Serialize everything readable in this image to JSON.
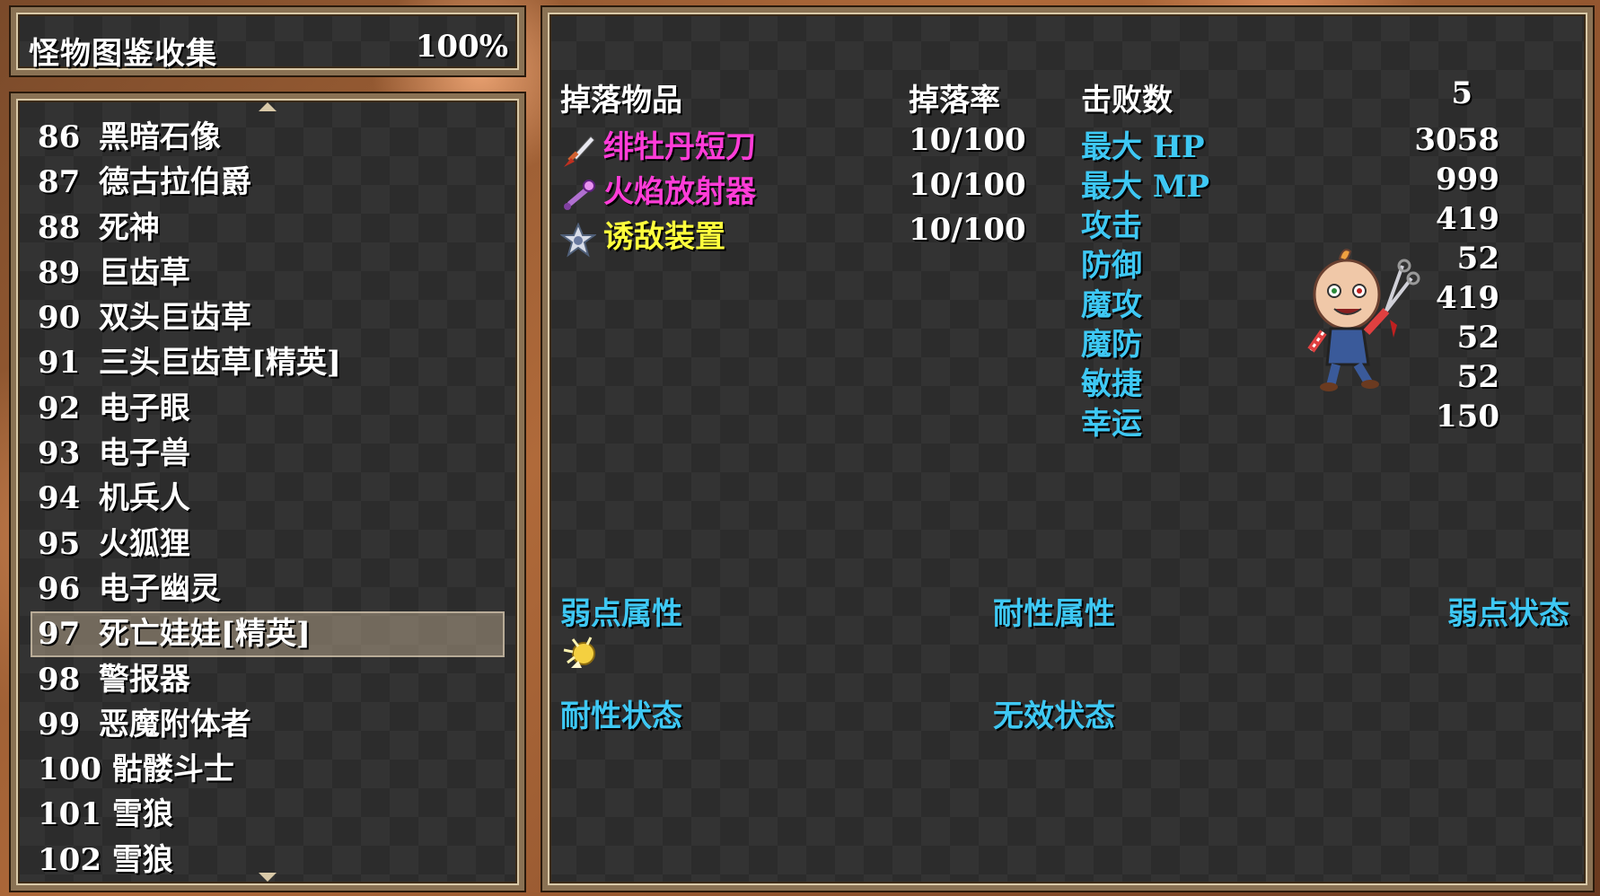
{
  "title": {
    "label": "怪物图鉴收集",
    "percent": "100%"
  },
  "list": [
    {
      "num": "86",
      "name": "黑暗石像"
    },
    {
      "num": "87",
      "name": "德古拉伯爵"
    },
    {
      "num": "88",
      "name": "死神"
    },
    {
      "num": "89",
      "name": "巨齿草"
    },
    {
      "num": "90",
      "name": "双头巨齿草"
    },
    {
      "num": "91",
      "name": "三头巨齿草[精英]"
    },
    {
      "num": "92",
      "name": "电子眼"
    },
    {
      "num": "93",
      "name": "电子兽"
    },
    {
      "num": "94",
      "name": "机兵人"
    },
    {
      "num": "95",
      "name": "火狐狸"
    },
    {
      "num": "96",
      "name": "电子幽灵"
    },
    {
      "num": "97",
      "name": "死亡娃娃[精英]"
    },
    {
      "num": "98",
      "name": "警报器"
    },
    {
      "num": "99",
      "name": "恶魔附体者"
    },
    {
      "num": "100",
      "name": "骷髅斗士"
    },
    {
      "num": "101",
      "name": "雪狼"
    },
    {
      "num": "102",
      "name": "雪狼"
    }
  ],
  "selected_index": 11,
  "drops": {
    "header_item": "掉落物品",
    "header_rate": "掉落率",
    "items": [
      {
        "name": "绯牡丹短刀",
        "rate": "10/100",
        "icon": "dagger-icon",
        "color": "#ff3cd8"
      },
      {
        "name": "火焰放射器",
        "rate": "10/100",
        "icon": "flamethrower-icon",
        "color": "#ff3cd8"
      },
      {
        "name": "诱敌装置",
        "rate": "10/100",
        "icon": "lure-device-icon",
        "color": "#ffff3c"
      }
    ]
  },
  "stats": {
    "defeats_label": "击败数",
    "defeats_value": "5",
    "rows": [
      {
        "label": "最大 HP",
        "value": "3058"
      },
      {
        "label": "最大 MP",
        "value": "999"
      },
      {
        "label": "攻击",
        "value": "419"
      },
      {
        "label": "防御",
        "value": "52"
      },
      {
        "label": "魔攻",
        "value": "419"
      },
      {
        "label": "魔防",
        "value": "52"
      },
      {
        "label": "敏捷",
        "value": "52"
      },
      {
        "label": "幸运",
        "value": "150"
      }
    ]
  },
  "attributes": {
    "weak_element": "弱点属性",
    "resist_element": "耐性属性",
    "weak_state": "弱点状态",
    "resist_state": "耐性状态",
    "immune_state": "无效状态",
    "weak_element_icon": "light-element-icon"
  },
  "colors": {
    "label_blue": "#3ec8f4",
    "rare_item": "#ff3cd8",
    "common_item": "#ffff3c"
  }
}
